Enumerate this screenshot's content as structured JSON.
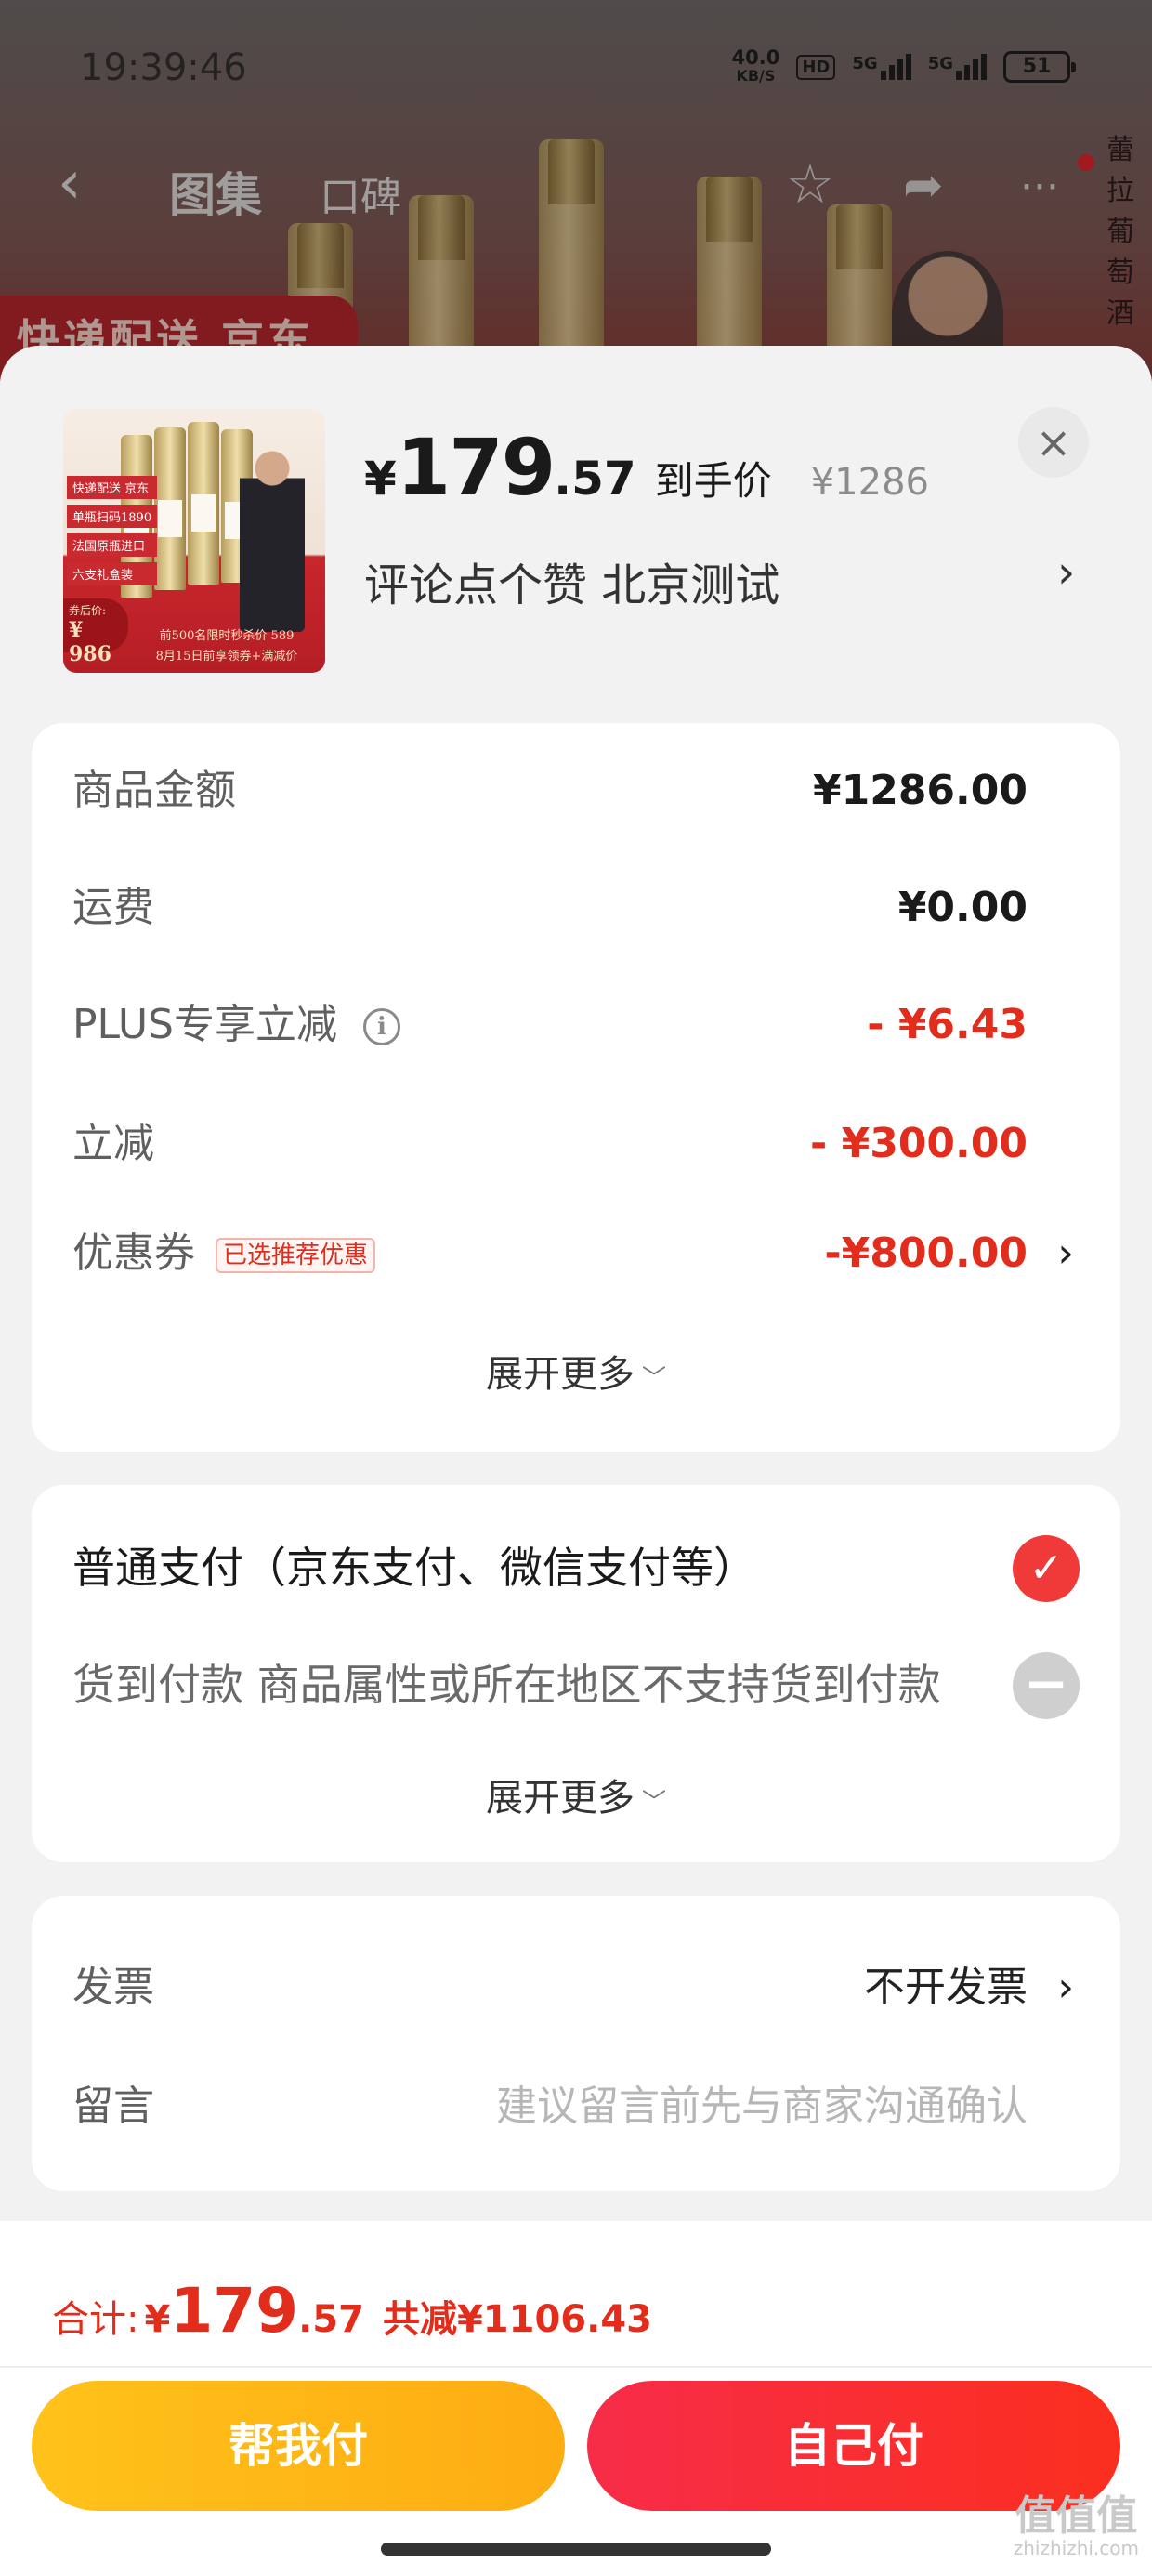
{
  "status_bar": {
    "time": "19:39:46",
    "net_speed": "40.0",
    "net_unit": "KB/S",
    "hd": "HD",
    "sim1": "5G",
    "sim2": "5G",
    "battery": "51"
  },
  "background_page": {
    "tabs": [
      "图集",
      "口碑"
    ],
    "banner_text": "快递配送 京东",
    "vertical_text": "蕾拉葡萄酒"
  },
  "product": {
    "price_symbol": "¥",
    "price_int": "179",
    "price_dec": ".57",
    "price_label": "到手价",
    "original_price": "¥1286",
    "subtitle": "评论点个赞  北京测试",
    "thumb": {
      "tags": [
        "快递配送 京东",
        "单瓶扫码1890",
        "法国原瓶进口",
        "六支礼盒装"
      ],
      "promo_label": "券后价:",
      "promo_price": "¥ 986",
      "footer_line1": "前500名限时秒杀价 589",
      "footer_line2": "8月15日前享领券+满减价"
    }
  },
  "amounts": {
    "rows": [
      {
        "label": "商品金额",
        "value": "¥1286.00"
      },
      {
        "label": "运费",
        "value": "¥0.00"
      },
      {
        "label": "PLUS专享立减",
        "value": "- ¥6.43"
      },
      {
        "label": "立减",
        "value": "- ¥300.00"
      },
      {
        "label": "优惠券",
        "badge": "已选推荐优惠",
        "value": "-¥800.00"
      }
    ],
    "expand_label": "展开更多"
  },
  "payment": {
    "option_normal": "普通支付（京东支付、微信支付等）",
    "option_cod": "货到付款  商品属性或所在地区不支持货到付款",
    "expand_label": "展开更多"
  },
  "extra": {
    "invoice_label": "发票",
    "invoice_value": "不开发票",
    "message_label": "留言",
    "message_placeholder": "建议留言前先与商家沟通确认"
  },
  "footer": {
    "total_label": "合计:",
    "total_symbol": "¥",
    "total_int": "179",
    "total_dec": ".57",
    "total_saved": "共减¥1106.43",
    "btn_help": "帮我付",
    "btn_self": "自己付"
  },
  "watermark": {
    "main": "值值值",
    "sub": "zhizhizhi.com"
  },
  "colors": {
    "accent_red": "#e22c1c",
    "pay_yellow": "#ffc21a",
    "pay_red": "#f72c48"
  }
}
